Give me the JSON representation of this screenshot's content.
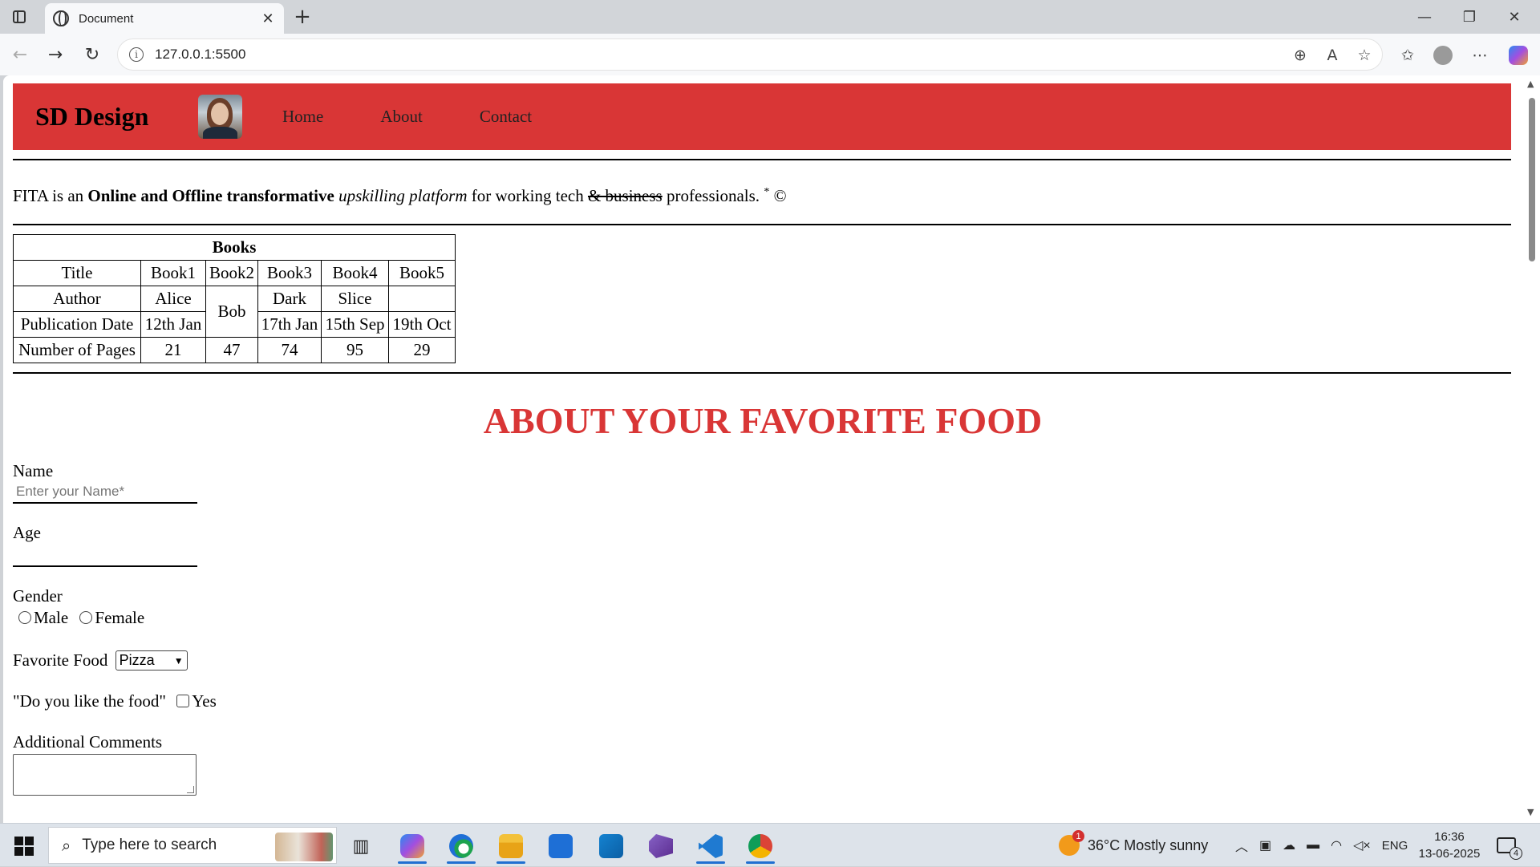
{
  "browser": {
    "tab_title": "Document",
    "url": "127.0.0.1:5500"
  },
  "site": {
    "brand": "SD Design",
    "nav": [
      "Home",
      "About",
      "Contact"
    ]
  },
  "intro": {
    "p1": "FITA is an ",
    "bold": "Online and Offline transformative",
    "italic": "upskilling platform",
    "p2": " for working tech ",
    "strike": "& business",
    "p3": " professionals.",
    "sup": "*",
    "copy": "©"
  },
  "books_table": {
    "caption": "Books",
    "row_title": [
      "Title",
      "Book1",
      "Book2",
      "Book3",
      "Book4",
      "Book5"
    ],
    "row_author": [
      "Author",
      "Alice",
      "Bob",
      "Dark",
      "Slice",
      ""
    ],
    "row_date": [
      "Publication Date",
      "12th Jan",
      "17th Jan",
      "15th Sep",
      "19th Oct"
    ],
    "row_pages": [
      "Number of Pages",
      "21",
      "47",
      "74",
      "95",
      "29"
    ]
  },
  "form": {
    "heading": "ABOUT YOUR FAVORITE FOOD",
    "name_label": "Name",
    "name_placeholder": "Enter your Name*",
    "age_label": "Age",
    "gender_label": "Gender",
    "gender_options": [
      "Male",
      "Female"
    ],
    "food_label": "Favorite Food",
    "food_selected": "Pizza",
    "like_label": "\"Do you like the food\"",
    "like_option": "Yes",
    "comments_label": "Additional Comments"
  },
  "taskbar": {
    "search_placeholder": "Type here to search",
    "weather": "36°C  Mostly sunny",
    "weather_badge": "1",
    "lang": "ENG",
    "time": "16:36",
    "date": "13-06-2025",
    "notif_count": "4"
  }
}
